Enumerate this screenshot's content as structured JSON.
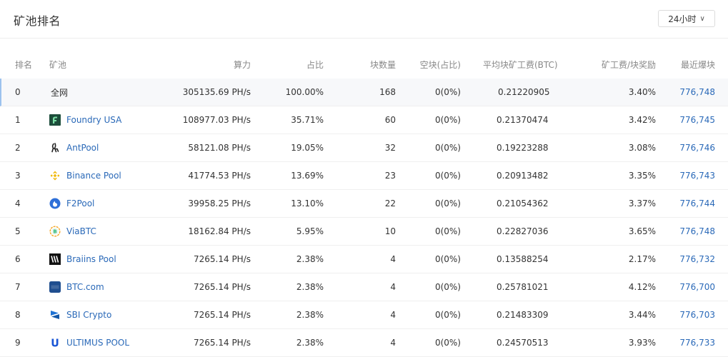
{
  "header": {
    "title": "矿池排名",
    "period_label": "24小时"
  },
  "table": {
    "columns": [
      "排名",
      "矿池",
      "算力",
      "占比",
      "块数量",
      "空块(占比)",
      "平均块矿工费(BTC)",
      "矿工费/块奖励",
      "最近爆块"
    ],
    "total": {
      "rank": "0",
      "pool": "全网",
      "hashrate": "305135.69 PH/s",
      "share": "100.00%",
      "blocks": "168",
      "empty": "0(0%)",
      "avg_fee": "0.21220905",
      "fee_ratio": "3.40%",
      "latest": "776,748"
    },
    "rows": [
      {
        "rank": "1",
        "pool": "Foundry USA",
        "icon": "foundry-icon",
        "hashrate": "108977.03 PH/s",
        "share": "35.71%",
        "blocks": "60",
        "empty": "0(0%)",
        "avg_fee": "0.21370474",
        "fee_ratio": "3.42%",
        "latest": "776,745"
      },
      {
        "rank": "2",
        "pool": "AntPool",
        "icon": "antpool-icon",
        "hashrate": "58121.08 PH/s",
        "share": "19.05%",
        "blocks": "32",
        "empty": "0(0%)",
        "avg_fee": "0.19223288",
        "fee_ratio": "3.08%",
        "latest": "776,746"
      },
      {
        "rank": "3",
        "pool": "Binance Pool",
        "icon": "binance-icon",
        "hashrate": "41774.53 PH/s",
        "share": "13.69%",
        "blocks": "23",
        "empty": "0(0%)",
        "avg_fee": "0.20913482",
        "fee_ratio": "3.35%",
        "latest": "776,743"
      },
      {
        "rank": "4",
        "pool": "F2Pool",
        "icon": "f2pool-icon",
        "hashrate": "39958.25 PH/s",
        "share": "13.10%",
        "blocks": "22",
        "empty": "0(0%)",
        "avg_fee": "0.21054362",
        "fee_ratio": "3.37%",
        "latest": "776,744"
      },
      {
        "rank": "5",
        "pool": "ViaBTC",
        "icon": "viabtc-icon",
        "hashrate": "18162.84 PH/s",
        "share": "5.95%",
        "blocks": "10",
        "empty": "0(0%)",
        "avg_fee": "0.22827036",
        "fee_ratio": "3.65%",
        "latest": "776,748"
      },
      {
        "rank": "6",
        "pool": "Braiins Pool",
        "icon": "braiins-icon",
        "hashrate": "7265.14 PH/s",
        "share": "2.38%",
        "blocks": "4",
        "empty": "0(0%)",
        "avg_fee": "0.13588254",
        "fee_ratio": "2.17%",
        "latest": "776,732"
      },
      {
        "rank": "7",
        "pool": "BTC.com",
        "icon": "btccom-icon",
        "hashrate": "7265.14 PH/s",
        "share": "2.38%",
        "blocks": "4",
        "empty": "0(0%)",
        "avg_fee": "0.25781021",
        "fee_ratio": "4.12%",
        "latest": "776,700"
      },
      {
        "rank": "8",
        "pool": "SBI Crypto",
        "icon": "sbicrypto-icon",
        "hashrate": "7265.14 PH/s",
        "share": "2.38%",
        "blocks": "4",
        "empty": "0(0%)",
        "avg_fee": "0.21483309",
        "fee_ratio": "3.44%",
        "latest": "776,703"
      },
      {
        "rank": "9",
        "pool": "ULTIMUS POOL",
        "icon": "ultimus-icon",
        "hashrate": "7265.14 PH/s",
        "share": "2.38%",
        "blocks": "4",
        "empty": "0(0%)",
        "avg_fee": "0.24570513",
        "fee_ratio": "3.93%",
        "latest": "776,733"
      }
    ]
  },
  "colors": {
    "link": "#2a69b8",
    "foundry": "#1d4d3b",
    "binance": "#f0b90b",
    "f2pool": "#2e6fd8",
    "viabtc": "#f5a623",
    "ultimus": "#1a56d6"
  }
}
